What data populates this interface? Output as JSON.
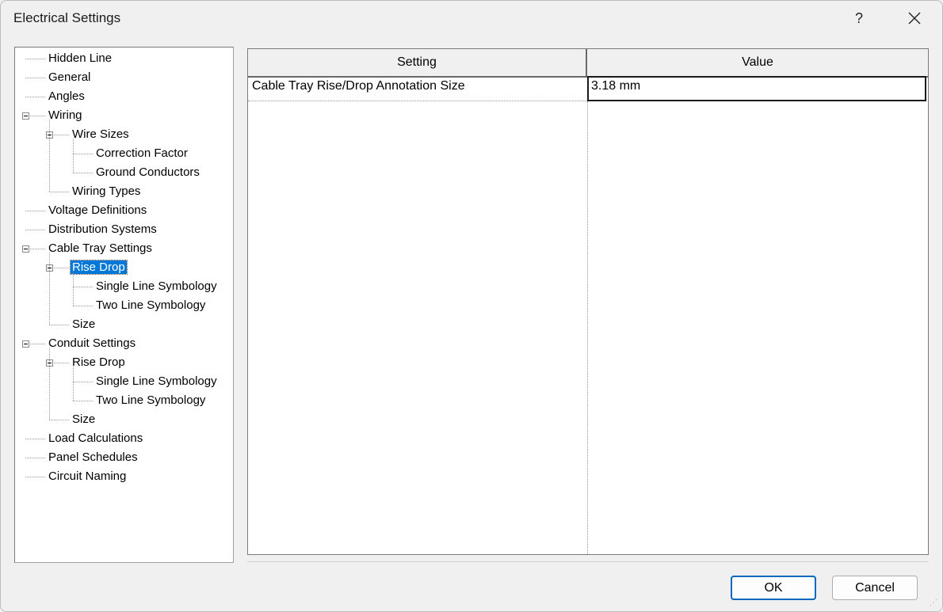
{
  "window": {
    "title": "Electrical Settings",
    "help_label": "?"
  },
  "tree": [
    {
      "id": "hidden-line",
      "label": "Hidden Line",
      "level": 0
    },
    {
      "id": "general",
      "label": "General",
      "level": 0
    },
    {
      "id": "angles",
      "label": "Angles",
      "level": 0
    },
    {
      "id": "wiring",
      "label": "Wiring",
      "level": 0,
      "expanded": true
    },
    {
      "id": "wire-sizes",
      "label": "Wire Sizes",
      "level": 1,
      "expanded": true
    },
    {
      "id": "correction-factor",
      "label": "Correction Factor",
      "level": 2
    },
    {
      "id": "ground-conductors",
      "label": "Ground Conductors",
      "level": 2
    },
    {
      "id": "wiring-types",
      "label": "Wiring Types",
      "level": 1
    },
    {
      "id": "voltage-definitions",
      "label": "Voltage Definitions",
      "level": 0
    },
    {
      "id": "distribution-systems",
      "label": "Distribution Systems",
      "level": 0
    },
    {
      "id": "cable-tray-settings",
      "label": "Cable Tray Settings",
      "level": 0,
      "expanded": true
    },
    {
      "id": "cable-tray-rise-drop",
      "label": "Rise Drop",
      "level": 1,
      "expanded": true,
      "selected": true
    },
    {
      "id": "cable-tray-single-line",
      "label": "Single Line Symbology",
      "level": 2
    },
    {
      "id": "cable-tray-two-line",
      "label": "Two Line Symbology",
      "level": 2
    },
    {
      "id": "cable-tray-size",
      "label": "Size",
      "level": 1
    },
    {
      "id": "conduit-settings",
      "label": "Conduit Settings",
      "level": 0,
      "expanded": true
    },
    {
      "id": "conduit-rise-drop",
      "label": "Rise Drop",
      "level": 1,
      "expanded": true
    },
    {
      "id": "conduit-single-line",
      "label": "Single Line Symbology",
      "level": 2
    },
    {
      "id": "conduit-two-line",
      "label": "Two Line Symbology",
      "level": 2
    },
    {
      "id": "conduit-size",
      "label": "Size",
      "level": 1
    },
    {
      "id": "load-calculations",
      "label": "Load Calculations",
      "level": 0
    },
    {
      "id": "panel-schedules",
      "label": "Panel Schedules",
      "level": 0
    },
    {
      "id": "circuit-naming",
      "label": "Circuit Naming",
      "level": 0
    }
  ],
  "grid": {
    "headers": {
      "setting": "Setting",
      "value": "Value"
    },
    "rows": [
      {
        "setting": "Cable Tray Rise/Drop Annotation Size",
        "value": "3.18 mm"
      }
    ]
  },
  "buttons": {
    "ok": "OK",
    "cancel": "Cancel"
  },
  "colors": {
    "selection": "#0078d7",
    "primary_border": "#0067c0"
  }
}
